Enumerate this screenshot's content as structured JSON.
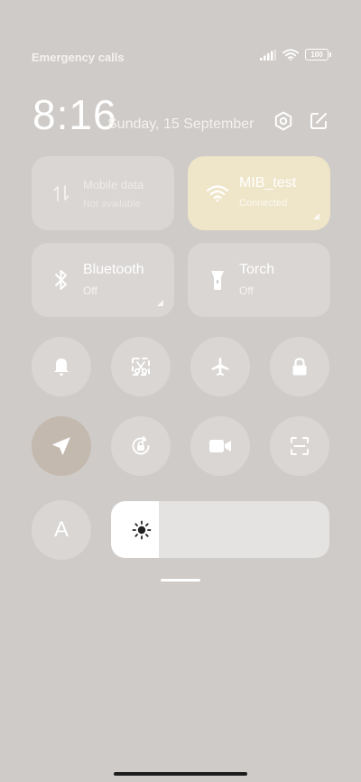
{
  "status_bar": {
    "carrier_text": "Emergency calls",
    "battery_level": "100",
    "icons": [
      "signal-icon",
      "wifi-icon",
      "battery-icon"
    ]
  },
  "header": {
    "time": "8:16",
    "date": "Sunday, 15 September",
    "settings_icon": "gear-icon",
    "edit_icon": "edit-icon"
  },
  "tiles": {
    "mobile_data": {
      "label": "Mobile data",
      "status": "Not available",
      "icon": "mobile-data-icon",
      "enabled": false
    },
    "wifi": {
      "label": "MIB_test",
      "status": "Connected",
      "icon": "wifi-icon",
      "active": true
    },
    "bluetooth": {
      "label": "Bluetooth",
      "status": "Off",
      "icon": "bluetooth-icon"
    },
    "torch": {
      "label": "Torch",
      "status": "Off",
      "icon": "torch-icon"
    }
  },
  "round_buttons": [
    {
      "name": "bell-icon"
    },
    {
      "name": "screenshot-icon"
    },
    {
      "name": "airplane-icon"
    },
    {
      "name": "lock-icon"
    },
    {
      "name": "location-icon",
      "active": true
    },
    {
      "name": "rotation-lock-icon"
    },
    {
      "name": "video-camera-icon"
    },
    {
      "name": "scan-icon"
    },
    {
      "name": "auto-brightness-icon",
      "label": "A"
    }
  ],
  "brightness": {
    "level": 0.22,
    "icon": "sun-icon"
  },
  "colors": {
    "background": "#cfcbc8",
    "tile": "rgba(255,255,255,0.22)",
    "tile_active": "#efe5c9",
    "round_active": "#c4b9ae",
    "brightness_fill": "#ffffff",
    "brightness_track": "#e4e3e1"
  }
}
